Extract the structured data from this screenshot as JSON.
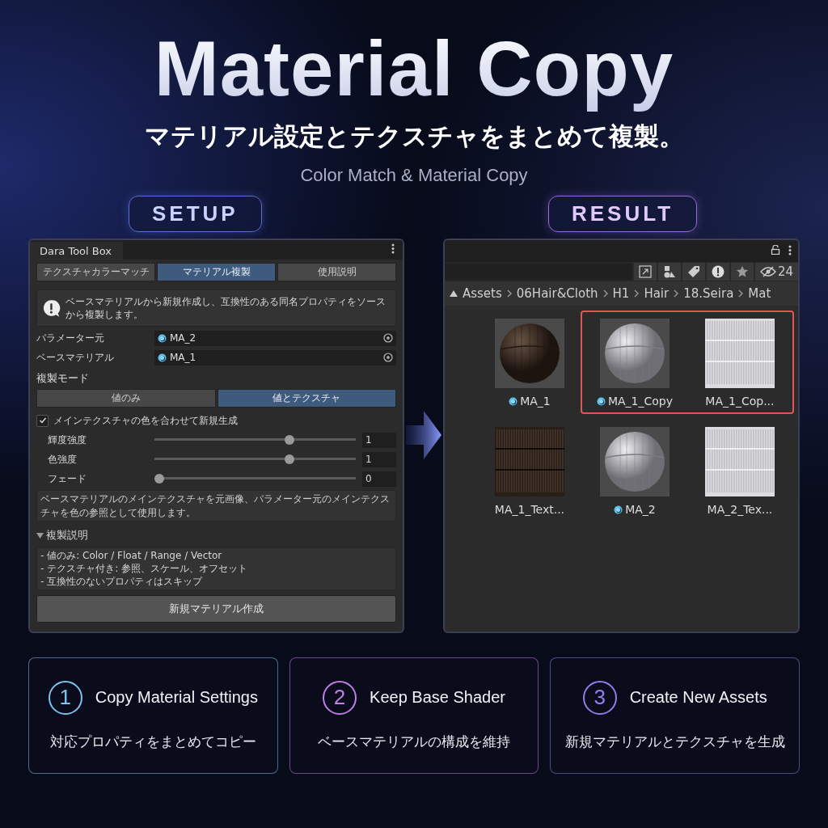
{
  "header": {
    "title": "Material Copy",
    "subtitle": "マテリアル設定とテクスチャをまとめて複製。",
    "caption": "Color Match & Material Copy"
  },
  "setup": {
    "label": "SETUP",
    "window_title": "Dara Tool Box",
    "tabs": [
      {
        "label": "テクスチャカラーマッチ",
        "selected": false
      },
      {
        "label": "マテリアル複製",
        "selected": true
      },
      {
        "label": "使用説明",
        "selected": false
      }
    ],
    "info": "ベースマテリアルから新規作成し、互換性のある同名プロパティをソースから複製します。",
    "fields": [
      {
        "label": "パラメーター元",
        "value": "MA_2"
      },
      {
        "label": "ベースマテリアル",
        "value": "MA_1"
      }
    ],
    "mode_heading": "複製モード",
    "modes": [
      {
        "label": "値のみ",
        "selected": false
      },
      {
        "label": "値とテクスチャ",
        "selected": true
      }
    ],
    "match_option": {
      "label": "メインテクスチャの色を合わせて新規生成",
      "checked": true
    },
    "sliders": [
      {
        "label": "輝度強度",
        "level": 0.68,
        "value": "1"
      },
      {
        "label": "色強度",
        "level": 0.68,
        "value": "1"
      },
      {
        "label": "フェード",
        "level": 0,
        "value": "0"
      }
    ],
    "note": "ベースマテリアルのメインテクスチャを元画像、パラメーター元のメインテクスチャを色の参照として使用します。",
    "foldout": {
      "label": "複製説明",
      "expanded": true,
      "lines": [
        "- 値のみ: Color / Float / Range / Vector",
        "- テクスチャ付き: 参照、スケール、オフセット",
        "- 互換性のないプロパティはスキップ"
      ]
    },
    "create_button": "新規マテリアル作成"
  },
  "result": {
    "label": "RESULT",
    "hidden_count": "24",
    "breadcrumb": [
      "Assets",
      "06Hair&Cloth",
      "H1",
      "Hair",
      "18.Seira",
      "Mat"
    ],
    "assets": [
      {
        "name": "MA_1",
        "kind": "material",
        "dark": true,
        "highlighted": false
      },
      {
        "name": "MA_1_Copy",
        "kind": "material",
        "dark": false,
        "highlighted": true
      },
      {
        "name": "MA_1_Cop...",
        "kind": "texture",
        "dark": false,
        "highlighted": true
      },
      {
        "name": "MA_1_Text...",
        "kind": "texture",
        "dark": true,
        "highlighted": false
      },
      {
        "name": "MA_2",
        "kind": "material",
        "dark": false,
        "highlighted": false
      },
      {
        "name": "MA_2_Tex...",
        "kind": "texture",
        "dark": false,
        "highlighted": false
      }
    ]
  },
  "features": [
    {
      "number": "1",
      "title": "Copy Material Settings",
      "description": "対応プロパティをまとめてコピー",
      "color": "#7cc4ee"
    },
    {
      "number": "2",
      "title": "Keep Base Shader",
      "description": "ベースマテリアルの構成を維持",
      "color": "#c17ee8"
    },
    {
      "number": "3",
      "title": "Create New Assets",
      "description": "新規マテリアルとテクスチャを生成",
      "color": "#8d80ee"
    }
  ]
}
